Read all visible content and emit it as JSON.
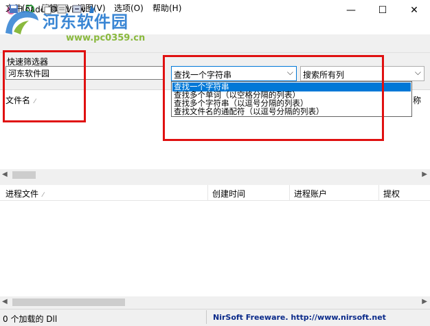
{
  "window": {
    "title": "LoadedDllsView",
    "minimize_symbol": "—",
    "maximize_symbol": "☐",
    "close_symbol": "✕"
  },
  "watermark": {
    "title": "河东软件园",
    "url": "www.pc0359.cn"
  },
  "menu": [
    "文件(F)",
    "编辑(E)",
    "视图(V)",
    "选项(O)",
    "帮助(H)"
  ],
  "toolbar_icons": [
    "save-icon",
    "refresh-icon",
    "copy-icon",
    "properties-icon",
    "export-icon",
    "about-icon"
  ],
  "filter": {
    "label": "快速筛选器",
    "value": "河东软件园",
    "mode_selected": "查找一个字符串",
    "scope_selected": "搜索所有列",
    "options": [
      "查找一个字符串",
      "查找多个单词（以空格分隔的列表）",
      "查找多个字符串（以逗号分隔的列表）",
      "查找文件名的通配符（以逗号分隔的列表）"
    ]
  },
  "upper_list": {
    "columns": [
      "文件名",
      "称"
    ]
  },
  "lower_list": {
    "columns": [
      "进程文件",
      "创建时间",
      "进程账户",
      "提权"
    ]
  },
  "status": {
    "count": "0 个加载的 Dll",
    "link": "NirSoft Freeware.  http://www.nirsoft.net"
  },
  "colors": {
    "accent": "#0078d7",
    "annotation_red": "#e01010",
    "watermark_blue": "#3a86d4",
    "watermark_green": "#8ab93e"
  }
}
